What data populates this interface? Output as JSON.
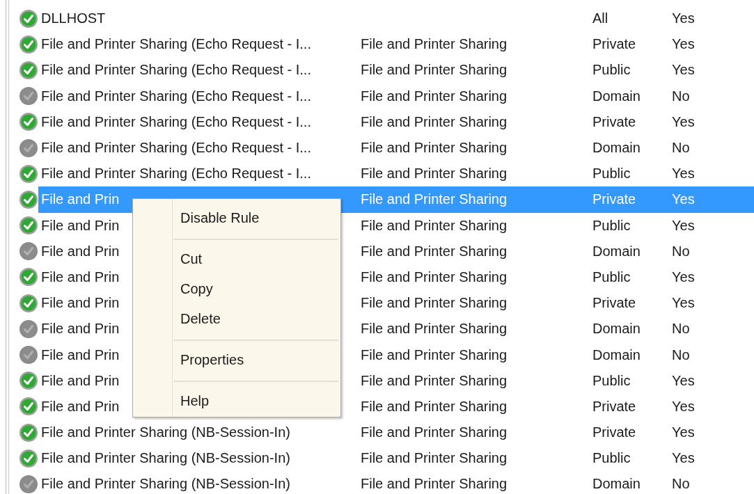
{
  "rules": [
    {
      "name": "DLLHOST",
      "profile": "All",
      "enabled": "Yes",
      "active": true,
      "selected": false
    },
    {
      "name": "File and Printer Sharing (Echo Request - I...",
      "group": "File and Printer Sharing",
      "profile": "Private",
      "enabled": "Yes",
      "active": true,
      "selected": false
    },
    {
      "name": "File and Printer Sharing (Echo Request - I...",
      "group": "File and Printer Sharing",
      "profile": "Public",
      "enabled": "Yes",
      "active": true,
      "selected": false
    },
    {
      "name": "File and Printer Sharing (Echo Request - I...",
      "group": "File and Printer Sharing",
      "profile": "Domain",
      "enabled": "No",
      "active": false,
      "selected": false
    },
    {
      "name": "File and Printer Sharing (Echo Request - I...",
      "group": "File and Printer Sharing",
      "profile": "Private",
      "enabled": "Yes",
      "active": true,
      "selected": false
    },
    {
      "name": "File and Printer Sharing (Echo Request - I...",
      "group": "File and Printer Sharing",
      "profile": "Domain",
      "enabled": "No",
      "active": false,
      "selected": false
    },
    {
      "name": "File and Printer Sharing (Echo Request - I...",
      "group": "File and Printer Sharing",
      "profile": "Public",
      "enabled": "Yes",
      "active": true,
      "selected": false
    },
    {
      "name": "File and Prin",
      "group": "File and Printer Sharing",
      "profile": "Private",
      "enabled": "Yes",
      "active": true,
      "selected": true
    },
    {
      "name": "File and Prin",
      "group": "File and Printer Sharing",
      "profile": "Public",
      "enabled": "Yes",
      "active": true,
      "selected": false
    },
    {
      "name": "File and Prin",
      "group": "File and Printer Sharing",
      "profile": "Domain",
      "enabled": "No",
      "active": false,
      "selected": false
    },
    {
      "name": "File and Prin",
      "group": "File and Printer Sharing",
      "profile": "Public",
      "enabled": "Yes",
      "active": true,
      "selected": false
    },
    {
      "name": "File and Prin",
      "group": "File and Printer Sharing",
      "profile": "Private",
      "enabled": "Yes",
      "active": true,
      "selected": false
    },
    {
      "name": "File and Prin",
      "group": "File and Printer Sharing",
      "profile": "Domain",
      "enabled": "No",
      "active": false,
      "selected": false
    },
    {
      "name": "File and Prin",
      "group": "File and Printer Sharing",
      "profile": "Domain",
      "enabled": "No",
      "active": false,
      "selected": false
    },
    {
      "name": "File and Prin",
      "group": "File and Printer Sharing",
      "profile": "Public",
      "enabled": "Yes",
      "active": true,
      "selected": false
    },
    {
      "name": "File and Prin",
      "group": "File and Printer Sharing",
      "profile": "Private",
      "enabled": "Yes",
      "active": true,
      "selected": false
    },
    {
      "name": "File and Printer Sharing (NB-Session-In)",
      "group": "File and Printer Sharing",
      "profile": "Private",
      "enabled": "Yes",
      "active": true,
      "selected": false
    },
    {
      "name": "File and Printer Sharing (NB-Session-In)",
      "group": "File and Printer Sharing",
      "profile": "Public",
      "enabled": "Yes",
      "active": true,
      "selected": false
    },
    {
      "name": "File and Printer Sharing (NB-Session-In)",
      "group": "File and Printer Sharing",
      "profile": "Domain",
      "enabled": "No",
      "active": false,
      "selected": false
    }
  ],
  "context_menu": {
    "items": [
      {
        "label": "Disable Rule",
        "separator_after": true
      },
      {
        "label": "Cut",
        "separator_after": false
      },
      {
        "label": "Copy",
        "separator_after": false
      },
      {
        "label": "Delete",
        "separator_after": true
      },
      {
        "label": "Properties",
        "separator_after": true
      },
      {
        "label": "Help",
        "separator_after": false
      }
    ]
  }
}
